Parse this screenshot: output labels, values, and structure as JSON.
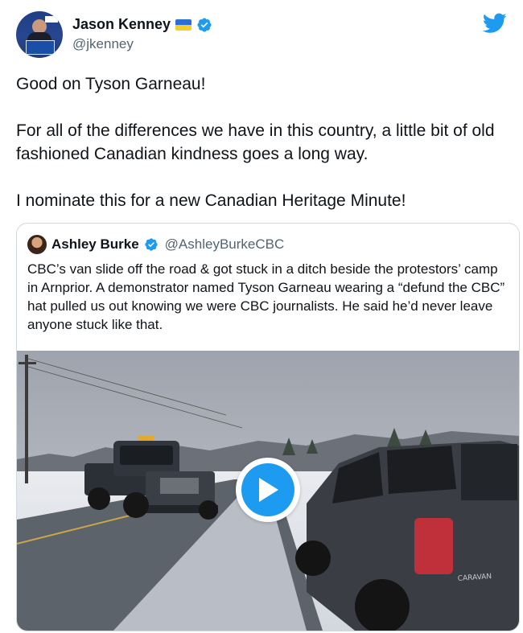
{
  "author": {
    "name": "Jason Kenney",
    "handle": "@jkenney",
    "flag": "ukraine-flag",
    "verified": true
  },
  "tweet": {
    "paragraphs": [
      "Good on Tyson Garneau!",
      "For all of the differences we have in this country, a little bit of old fashioned Canadian kindness goes a long way.",
      "I nominate this for a new Canadian Heritage Minute!"
    ]
  },
  "quoted": {
    "name": "Ashley Burke",
    "handle": "@AshleyBurkeCBC",
    "verified": true,
    "text": "CBC’s van slide off the road & got stuck in a ditch beside the protestors’ camp in Arnprior. A demonstrator named Tyson Garneau wearing a “defund the CBC” hat pulled us out knowing we were CBC journalists. He said he’d never leave anyone stuck like that."
  },
  "media": {
    "type": "video",
    "play_icon": "play-icon",
    "badge_text": "CARAVAN"
  },
  "colors": {
    "accent": "#1d9bf0",
    "text": "#0f1419",
    "secondary": "#536471",
    "border": "#cfd9de"
  }
}
